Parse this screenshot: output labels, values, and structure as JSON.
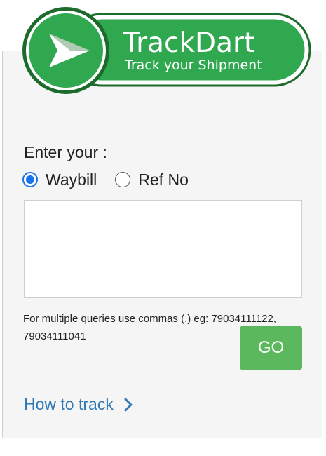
{
  "logo": {
    "brand": "TrackDart",
    "tagline": "Track your Shipment",
    "colors": {
      "green": "#2fa84f",
      "dark_green": "#1c6b2c",
      "white": "#ffffff"
    }
  },
  "form": {
    "prompt": "Enter your :",
    "options": [
      {
        "label": "Waybill",
        "selected": true
      },
      {
        "label": "Ref No",
        "selected": false
      }
    ],
    "query_value": "",
    "hint": "For multiple queries use commas (,) eg: 79034111122, 79034111041",
    "go_label": "GO",
    "go_color": "#5cb85c"
  },
  "help": {
    "link_label": "How to track",
    "link_color": "#337ab7",
    "icon": "chevron-right-icon"
  }
}
